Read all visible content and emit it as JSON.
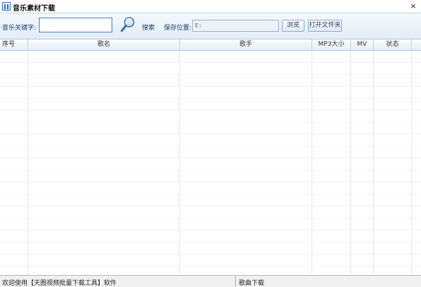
{
  "window": {
    "title": "音乐素材下载",
    "close_glyph": "×"
  },
  "toolbar": {
    "keyword_label": "音乐关键字:",
    "keyword_value": "",
    "search_label": "搜索",
    "save_location_label": "保存位置:",
    "save_path_value": "E:",
    "browse_label": "浏览",
    "open_folder_label": "打开文件夹"
  },
  "table": {
    "columns": [
      "序号",
      "歌名",
      "歌手",
      "MP3大小",
      "MV",
      "状态"
    ],
    "rows": []
  },
  "statusbar": {
    "left_text": "欢迎使用【天图视频批量下载工具】软件",
    "right_text": "歌曲下载"
  },
  "icons": {
    "app": "app-icon",
    "search": "magnifier-icon",
    "close": "close-icon"
  },
  "colors": {
    "accent_border": "#4a7fc3",
    "label_text": "#1b3a6b",
    "toolbar_bg": "#e2ecf7"
  }
}
